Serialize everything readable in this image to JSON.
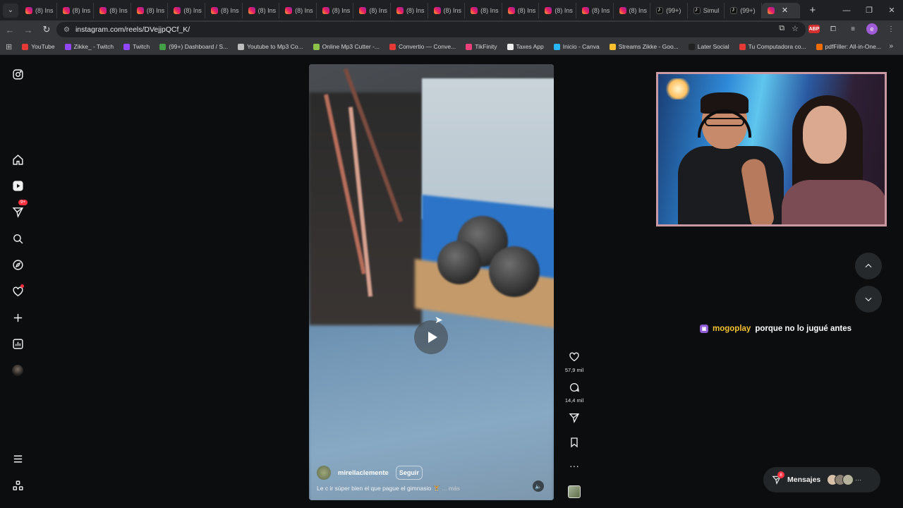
{
  "browser": {
    "tabs": [
      {
        "label": "(8) Ins",
        "kind": "ig"
      },
      {
        "label": "(8) Ins",
        "kind": "ig"
      },
      {
        "label": "(8) Ins",
        "kind": "ig"
      },
      {
        "label": "(8) Ins",
        "kind": "ig"
      },
      {
        "label": "(8) Ins",
        "kind": "ig"
      },
      {
        "label": "(8) Ins",
        "kind": "ig"
      },
      {
        "label": "(8) Ins",
        "kind": "ig"
      },
      {
        "label": "(8) Ins",
        "kind": "ig"
      },
      {
        "label": "(8) Ins",
        "kind": "ig"
      },
      {
        "label": "(8) Ins",
        "kind": "ig"
      },
      {
        "label": "(8) Ins",
        "kind": "ig"
      },
      {
        "label": "(8) Ins",
        "kind": "ig"
      },
      {
        "label": "(8) Ins",
        "kind": "ig"
      },
      {
        "label": "(8) Ins",
        "kind": "ig"
      },
      {
        "label": "(8) Ins",
        "kind": "ig"
      },
      {
        "label": "(8) Ins",
        "kind": "ig"
      },
      {
        "label": "(8) Ins",
        "kind": "ig"
      },
      {
        "label": "(99+)",
        "kind": "tt"
      },
      {
        "label": "Simul",
        "kind": "tt"
      },
      {
        "label": "(99+)",
        "kind": "tt"
      }
    ],
    "url": "instagram.com/reels/DVejjpQCf_K/",
    "bookmarks": [
      {
        "label": "YouTube",
        "color": "#e53935"
      },
      {
        "label": "Zikke_ - Twitch",
        "color": "#9146ff"
      },
      {
        "label": "Twitch",
        "color": "#9146ff"
      },
      {
        "label": "(99+) Dashboard / S...",
        "color": "#43a047"
      },
      {
        "label": "Youtube to Mp3 Co...",
        "color": "#bdbdbd"
      },
      {
        "label": "Online Mp3 Cutter -...",
        "color": "#8bc34a"
      },
      {
        "label": "Convertio — Conve...",
        "color": "#e53935"
      },
      {
        "label": "TikFinity",
        "color": "#ec407a"
      },
      {
        "label": "Taxes App",
        "color": "#eeeeee"
      },
      {
        "label": "Inicio - Canva",
        "color": "#29b6f6"
      },
      {
        "label": "Streams Zikke - Goo...",
        "color": "#fbc02d"
      },
      {
        "label": "Later Social",
        "color": "#212121"
      },
      {
        "label": "Tu Computadora co...",
        "color": "#e53935"
      },
      {
        "label": "pdfFiller: All-in-One...",
        "color": "#ef6c00"
      }
    ],
    "profile_initial": "e",
    "abp_label": "ABP"
  },
  "sidebar": {
    "notifications_badge": "9+"
  },
  "reel": {
    "username": "mirellaclemente",
    "follow_label": "Seguir",
    "caption": "Le c ir súper bien el que pague el gimnasio 🏋️",
    "caption_more": "... más",
    "likes": "57,9 mil",
    "comments": "14,4 mil"
  },
  "stream": {
    "chat_user": "mogoplay",
    "chat_text": "porque no lo jugué antes"
  },
  "messages": {
    "label": "Mensajes",
    "badge": "8"
  }
}
